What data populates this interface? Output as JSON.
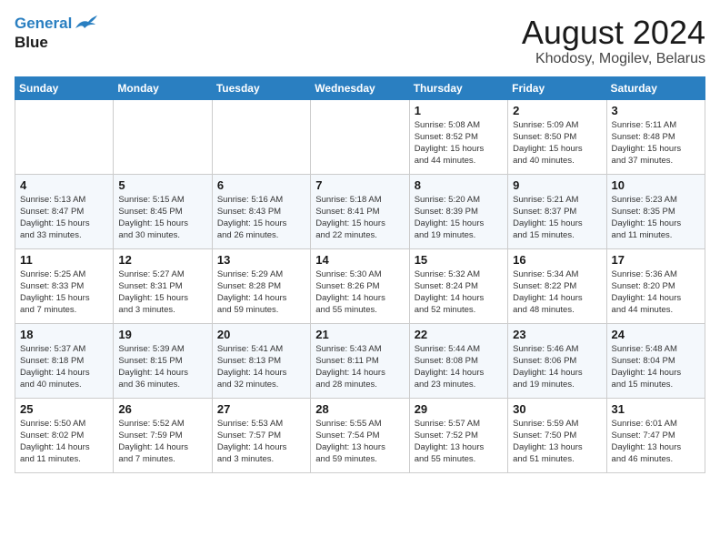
{
  "header": {
    "logo_line1": "General",
    "logo_line2": "Blue",
    "title": "August 2024",
    "subtitle": "Khodosy, Mogilev, Belarus"
  },
  "calendar": {
    "days_of_week": [
      "Sunday",
      "Monday",
      "Tuesday",
      "Wednesday",
      "Thursday",
      "Friday",
      "Saturday"
    ],
    "weeks": [
      [
        {
          "day": "",
          "info": ""
        },
        {
          "day": "",
          "info": ""
        },
        {
          "day": "",
          "info": ""
        },
        {
          "day": "",
          "info": ""
        },
        {
          "day": "1",
          "info": "Sunrise: 5:08 AM\nSunset: 8:52 PM\nDaylight: 15 hours\nand 44 minutes."
        },
        {
          "day": "2",
          "info": "Sunrise: 5:09 AM\nSunset: 8:50 PM\nDaylight: 15 hours\nand 40 minutes."
        },
        {
          "day": "3",
          "info": "Sunrise: 5:11 AM\nSunset: 8:48 PM\nDaylight: 15 hours\nand 37 minutes."
        }
      ],
      [
        {
          "day": "4",
          "info": "Sunrise: 5:13 AM\nSunset: 8:47 PM\nDaylight: 15 hours\nand 33 minutes."
        },
        {
          "day": "5",
          "info": "Sunrise: 5:15 AM\nSunset: 8:45 PM\nDaylight: 15 hours\nand 30 minutes."
        },
        {
          "day": "6",
          "info": "Sunrise: 5:16 AM\nSunset: 8:43 PM\nDaylight: 15 hours\nand 26 minutes."
        },
        {
          "day": "7",
          "info": "Sunrise: 5:18 AM\nSunset: 8:41 PM\nDaylight: 15 hours\nand 22 minutes."
        },
        {
          "day": "8",
          "info": "Sunrise: 5:20 AM\nSunset: 8:39 PM\nDaylight: 15 hours\nand 19 minutes."
        },
        {
          "day": "9",
          "info": "Sunrise: 5:21 AM\nSunset: 8:37 PM\nDaylight: 15 hours\nand 15 minutes."
        },
        {
          "day": "10",
          "info": "Sunrise: 5:23 AM\nSunset: 8:35 PM\nDaylight: 15 hours\nand 11 minutes."
        }
      ],
      [
        {
          "day": "11",
          "info": "Sunrise: 5:25 AM\nSunset: 8:33 PM\nDaylight: 15 hours\nand 7 minutes."
        },
        {
          "day": "12",
          "info": "Sunrise: 5:27 AM\nSunset: 8:31 PM\nDaylight: 15 hours\nand 3 minutes."
        },
        {
          "day": "13",
          "info": "Sunrise: 5:29 AM\nSunset: 8:28 PM\nDaylight: 14 hours\nand 59 minutes."
        },
        {
          "day": "14",
          "info": "Sunrise: 5:30 AM\nSunset: 8:26 PM\nDaylight: 14 hours\nand 55 minutes."
        },
        {
          "day": "15",
          "info": "Sunrise: 5:32 AM\nSunset: 8:24 PM\nDaylight: 14 hours\nand 52 minutes."
        },
        {
          "day": "16",
          "info": "Sunrise: 5:34 AM\nSunset: 8:22 PM\nDaylight: 14 hours\nand 48 minutes."
        },
        {
          "day": "17",
          "info": "Sunrise: 5:36 AM\nSunset: 8:20 PM\nDaylight: 14 hours\nand 44 minutes."
        }
      ],
      [
        {
          "day": "18",
          "info": "Sunrise: 5:37 AM\nSunset: 8:18 PM\nDaylight: 14 hours\nand 40 minutes."
        },
        {
          "day": "19",
          "info": "Sunrise: 5:39 AM\nSunset: 8:15 PM\nDaylight: 14 hours\nand 36 minutes."
        },
        {
          "day": "20",
          "info": "Sunrise: 5:41 AM\nSunset: 8:13 PM\nDaylight: 14 hours\nand 32 minutes."
        },
        {
          "day": "21",
          "info": "Sunrise: 5:43 AM\nSunset: 8:11 PM\nDaylight: 14 hours\nand 28 minutes."
        },
        {
          "day": "22",
          "info": "Sunrise: 5:44 AM\nSunset: 8:08 PM\nDaylight: 14 hours\nand 23 minutes."
        },
        {
          "day": "23",
          "info": "Sunrise: 5:46 AM\nSunset: 8:06 PM\nDaylight: 14 hours\nand 19 minutes."
        },
        {
          "day": "24",
          "info": "Sunrise: 5:48 AM\nSunset: 8:04 PM\nDaylight: 14 hours\nand 15 minutes."
        }
      ],
      [
        {
          "day": "25",
          "info": "Sunrise: 5:50 AM\nSunset: 8:02 PM\nDaylight: 14 hours\nand 11 minutes."
        },
        {
          "day": "26",
          "info": "Sunrise: 5:52 AM\nSunset: 7:59 PM\nDaylight: 14 hours\nand 7 minutes."
        },
        {
          "day": "27",
          "info": "Sunrise: 5:53 AM\nSunset: 7:57 PM\nDaylight: 14 hours\nand 3 minutes."
        },
        {
          "day": "28",
          "info": "Sunrise: 5:55 AM\nSunset: 7:54 PM\nDaylight: 13 hours\nand 59 minutes."
        },
        {
          "day": "29",
          "info": "Sunrise: 5:57 AM\nSunset: 7:52 PM\nDaylight: 13 hours\nand 55 minutes."
        },
        {
          "day": "30",
          "info": "Sunrise: 5:59 AM\nSunset: 7:50 PM\nDaylight: 13 hours\nand 51 minutes."
        },
        {
          "day": "31",
          "info": "Sunrise: 6:01 AM\nSunset: 7:47 PM\nDaylight: 13 hours\nand 46 minutes."
        }
      ]
    ]
  }
}
